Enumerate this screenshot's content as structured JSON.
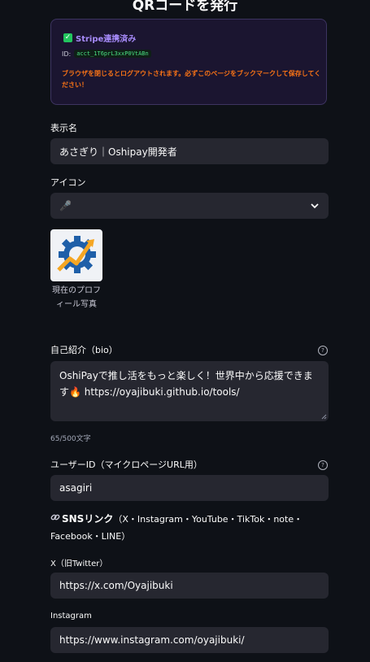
{
  "page": {
    "title": "QRコードを発行"
  },
  "stripe": {
    "status": "Stripe連携済み",
    "id_label": "ID:",
    "account_id": "acct_1T6prL3xxP0VtABn",
    "warning": "ブラウザを閉じるとログアウトされます。必ずこのページをブックマークして保存してください！"
  },
  "display_name": {
    "label": "表示名",
    "value": "あさぎり｜Oshipay開発者"
  },
  "icon": {
    "label": "アイコン",
    "selected": "🎤",
    "avatar_caption": "現在のプロフィール写真"
  },
  "bio": {
    "label": "自己紹介（bio）",
    "value": "OshiPayで推し活をもっと楽しく！世界中から応援できます🔥 https://oyajibuki.github.io/tools/",
    "counter": "65/500文字"
  },
  "user_id": {
    "label": "ユーザーID（マイクロページURL用）",
    "value": "asagiri"
  },
  "sns": {
    "title": "SNSリンク",
    "subtitle": "（X・Instagram・YouTube・TikTok・note・Facebook・LINE）",
    "x_label": "X（旧Twitter）",
    "x_value": "https://x.com/Oyajibuki",
    "instagram_label": "Instagram",
    "instagram_value": "https://www.instagram.com/oyajibuki/"
  },
  "icons": {
    "check": "check-icon",
    "help": "help-icon",
    "chevron": "chevron-down-icon",
    "link": "link-icon"
  },
  "colors": {
    "background": "#0e1117",
    "field": "#262730",
    "accent": "#a78bfa",
    "warning": "#f97316",
    "success": "#22c55e"
  }
}
